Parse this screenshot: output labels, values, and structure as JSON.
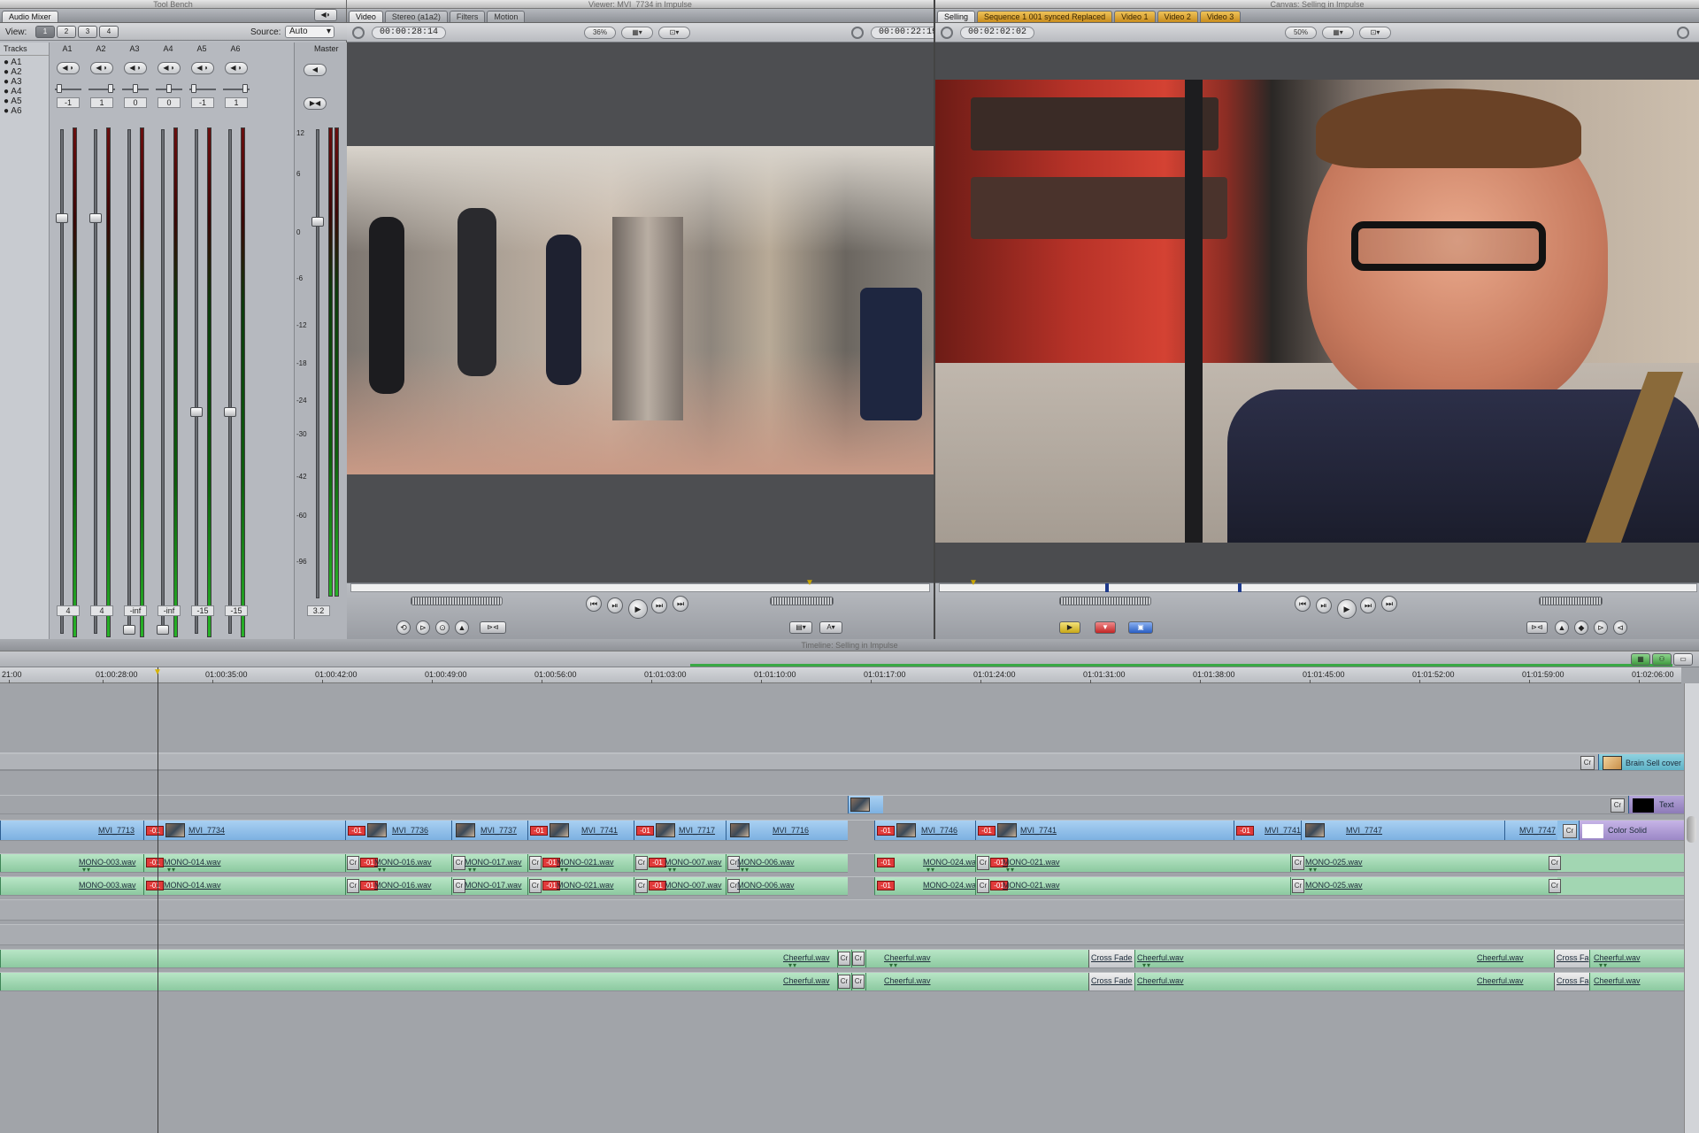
{
  "audio_mixer": {
    "title": "Audio Mixer",
    "window_title": "Tool Bench",
    "view_label": "View:",
    "view_buttons": [
      "1",
      "2",
      "3",
      "4"
    ],
    "source_label": "Source:",
    "source_value": "Auto",
    "tracks_header": "Tracks",
    "track_list": [
      "A1",
      "A2",
      "A3",
      "A4",
      "A5",
      "A6"
    ],
    "strips": [
      {
        "name": "A1",
        "pan": "-1",
        "level": "4",
        "fader": 0.83
      },
      {
        "name": "A2",
        "pan": "1",
        "level": "4",
        "fader": 0.83
      },
      {
        "name": "A3",
        "pan": "0",
        "level": "-inf",
        "fader": 0.0
      },
      {
        "name": "A4",
        "pan": "0",
        "level": "-inf",
        "fader": 0.0
      },
      {
        "name": "A5",
        "pan": "-1",
        "level": "-15",
        "fader": 0.44
      },
      {
        "name": "A6",
        "pan": "1",
        "level": "-15",
        "fader": 0.44
      }
    ],
    "master": {
      "name": "Master",
      "level": "3.2",
      "fader": 0.81
    },
    "scale": [
      "12",
      "6",
      "0",
      "-6",
      "-12",
      "-18",
      "-24",
      "-30",
      "-42",
      "-60",
      "-96"
    ]
  },
  "viewer": {
    "title": "Viewer: MVI_7734 in Impulse",
    "tabs": [
      "Video",
      "Stereo (a1a2)",
      "Filters",
      "Motion"
    ],
    "timecode_left": "00:00:28:14",
    "zoom": "36%",
    "timecode_right": "00:00:22:19"
  },
  "canvas": {
    "title": "Canvas: Selling in Impulse",
    "tabs": [
      "Selling",
      "Sequence 1 001 synced Replaced",
      "Video 1",
      "Video 2",
      "Video 3"
    ],
    "timecode": "00:02:02:02",
    "zoom": "50%"
  },
  "timeline": {
    "title": "Timeline: Selling in Impulse",
    "ruler": [
      "21:00",
      "01:00:28:00",
      "01:00:35:00",
      "01:00:42:00",
      "01:00:49:00",
      "01:00:56:00",
      "01:01:03:00",
      "01:01:10:00",
      "01:01:17:00",
      "01:01:24:00",
      "01:01:31:00",
      "01:01:38:00",
      "01:01:45:00",
      "01:01:52:00",
      "01:01:59:00",
      "01:02:06:00"
    ],
    "v3_clip": "Brain Sell cover",
    "v2_clip": "Text",
    "v1_clips": [
      "MVI_7713",
      "MVI_7734",
      "MVI_7736",
      "MVI_7737",
      "MVI_7741",
      "MVI_7717",
      "MVI_7716",
      "MVI_7746",
      "MVI_7741",
      "MVI_7741",
      "MVI_7747",
      "MVI_7747",
      "Color Solid"
    ],
    "a_clips": [
      "MONO-003.wav",
      "MONO-014.wav",
      "MONO-016.wav",
      "MONO-017.wav",
      "MONO-021.wav",
      "MONO-007.wav",
      "MONO-006.wav",
      "MONO-024.wav",
      "MONO-021.wav",
      "MONO-025.wav"
    ],
    "music_label": "Cheerful.wav",
    "crossfade": "Cross Fade",
    "crossfade_short": "Cross Fa",
    "red_tag": "-01",
    "trans_short": "Cr"
  },
  "colors": {
    "video_clip": "#8fc0ea",
    "audio_clip": "#a3d8b3",
    "red_tag": "#e13a3a",
    "accent_orange": "#e0a73a"
  }
}
